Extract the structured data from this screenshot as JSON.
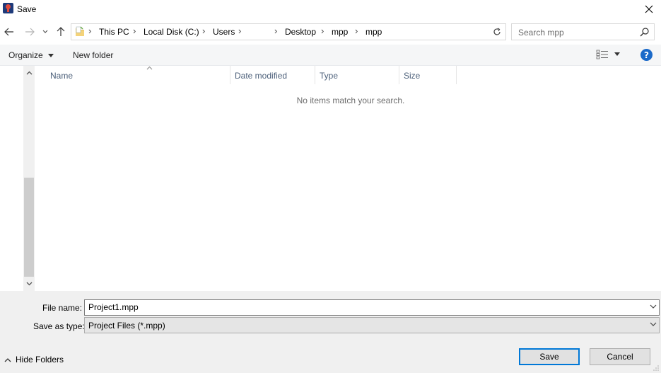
{
  "window": {
    "title": "Save"
  },
  "nav": {
    "breadcrumbs": [
      "This PC",
      "Local Disk (C:)",
      "Users",
      "",
      "Desktop",
      "mpp",
      "mpp"
    ]
  },
  "search": {
    "placeholder": "Search mpp"
  },
  "commands": {
    "organize": "Organize",
    "new_folder": "New folder",
    "help": "?"
  },
  "columns": [
    {
      "label": "Name"
    },
    {
      "label": "Date modified"
    },
    {
      "label": "Type"
    },
    {
      "label": "Size"
    }
  ],
  "list": {
    "empty_message": "No items match your search."
  },
  "save": {
    "file_name_label": "File name:",
    "file_name_value": "Project1.mpp",
    "save_as_type_label": "Save as type:",
    "save_as_type_value": "Project Files (*.mpp)"
  },
  "footer": {
    "hide_folders": "Hide Folders",
    "save_button": "Save",
    "cancel_button": "Cancel"
  },
  "colors": {
    "accent": "#0078d7",
    "help": "#1b6ac9",
    "header_text": "#4c607a"
  }
}
